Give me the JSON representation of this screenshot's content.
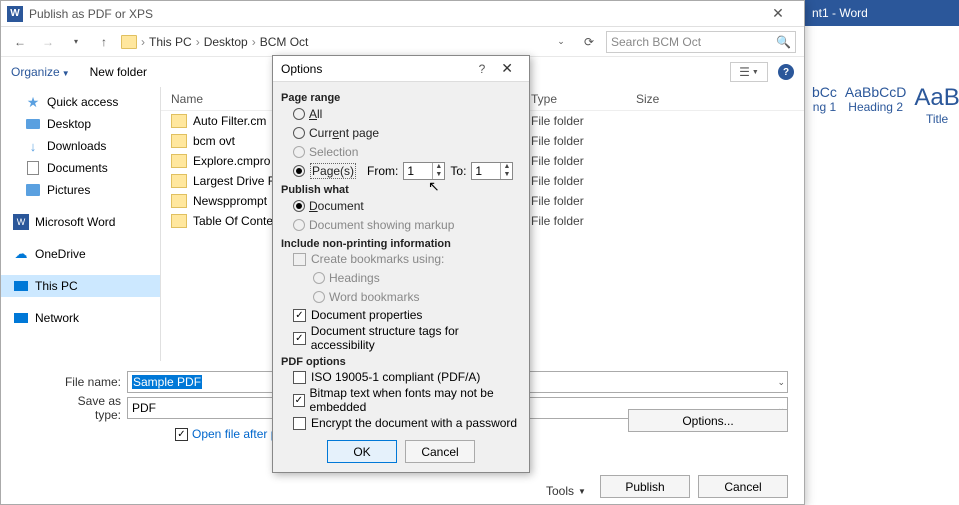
{
  "word": {
    "title": "nt1 - Word",
    "styles": [
      {
        "sample": "bCc",
        "label": "ng 1"
      },
      {
        "sample": "AaBbCcD",
        "label": "Heading 2"
      },
      {
        "sample": "AaB",
        "label": "Title"
      }
    ]
  },
  "publish": {
    "title": "Publish as PDF or XPS",
    "breadcrumb": [
      "This PC",
      "Desktop",
      "BCM Oct"
    ],
    "search_placeholder": "Search BCM Oct",
    "organize": "Organize",
    "new_folder": "New folder",
    "sidebar": [
      {
        "icon": "star",
        "label": "Quick access"
      },
      {
        "icon": "desktop",
        "label": "Desktop"
      },
      {
        "icon": "download",
        "label": "Downloads"
      },
      {
        "icon": "document",
        "label": "Documents"
      },
      {
        "icon": "picture",
        "label": "Pictures"
      },
      {
        "icon": "word",
        "label": "Microsoft Word"
      },
      {
        "icon": "cloud",
        "label": "OneDrive"
      },
      {
        "icon": "pc",
        "label": "This PC",
        "selected": true
      },
      {
        "icon": "network",
        "label": "Network"
      }
    ],
    "columns": {
      "name": "Name",
      "type": "Type",
      "size": "Size"
    },
    "files": [
      {
        "name": "Auto Filter.cm",
        "type": "File folder"
      },
      {
        "name": "bcm ovt",
        "type": "File folder"
      },
      {
        "name": "Explore.cmpro",
        "type": "File folder"
      },
      {
        "name": "Largest Drive F",
        "type": "File folder"
      },
      {
        "name": "Newspprompt",
        "type": "File folder"
      },
      {
        "name": "Table Of Conte",
        "type": "File folder"
      }
    ],
    "file_name_label": "File name:",
    "file_name_value": "Sample PDF",
    "save_as_label": "Save as type:",
    "save_as_value": "PDF",
    "open_after": "Open file after publishing",
    "options_btn": "Options...",
    "tools": "Tools",
    "publish_btn": "Publish",
    "cancel_btn": "Cancel"
  },
  "options": {
    "title": "Options",
    "page_range": {
      "label": "Page range",
      "all": "All",
      "current": "Current page",
      "selection": "Selection",
      "pages": "Page(s)",
      "from": "From:",
      "from_val": "1",
      "to": "To:",
      "to_val": "1"
    },
    "publish_what": {
      "label": "Publish what",
      "document": "Document",
      "markup": "Document showing markup"
    },
    "include": {
      "label": "Include non-printing information",
      "bookmarks": "Create bookmarks using:",
      "headings": "Headings",
      "word_bm": "Word bookmarks",
      "props": "Document properties",
      "tags": "Document structure tags for accessibility"
    },
    "pdf": {
      "label": "PDF options",
      "iso": "ISO 19005-1 compliant (PDF/A)",
      "bitmap": "Bitmap text when fonts may not be embedded",
      "encrypt": "Encrypt the document with a password"
    },
    "ok": "OK",
    "cancel": "Cancel"
  }
}
